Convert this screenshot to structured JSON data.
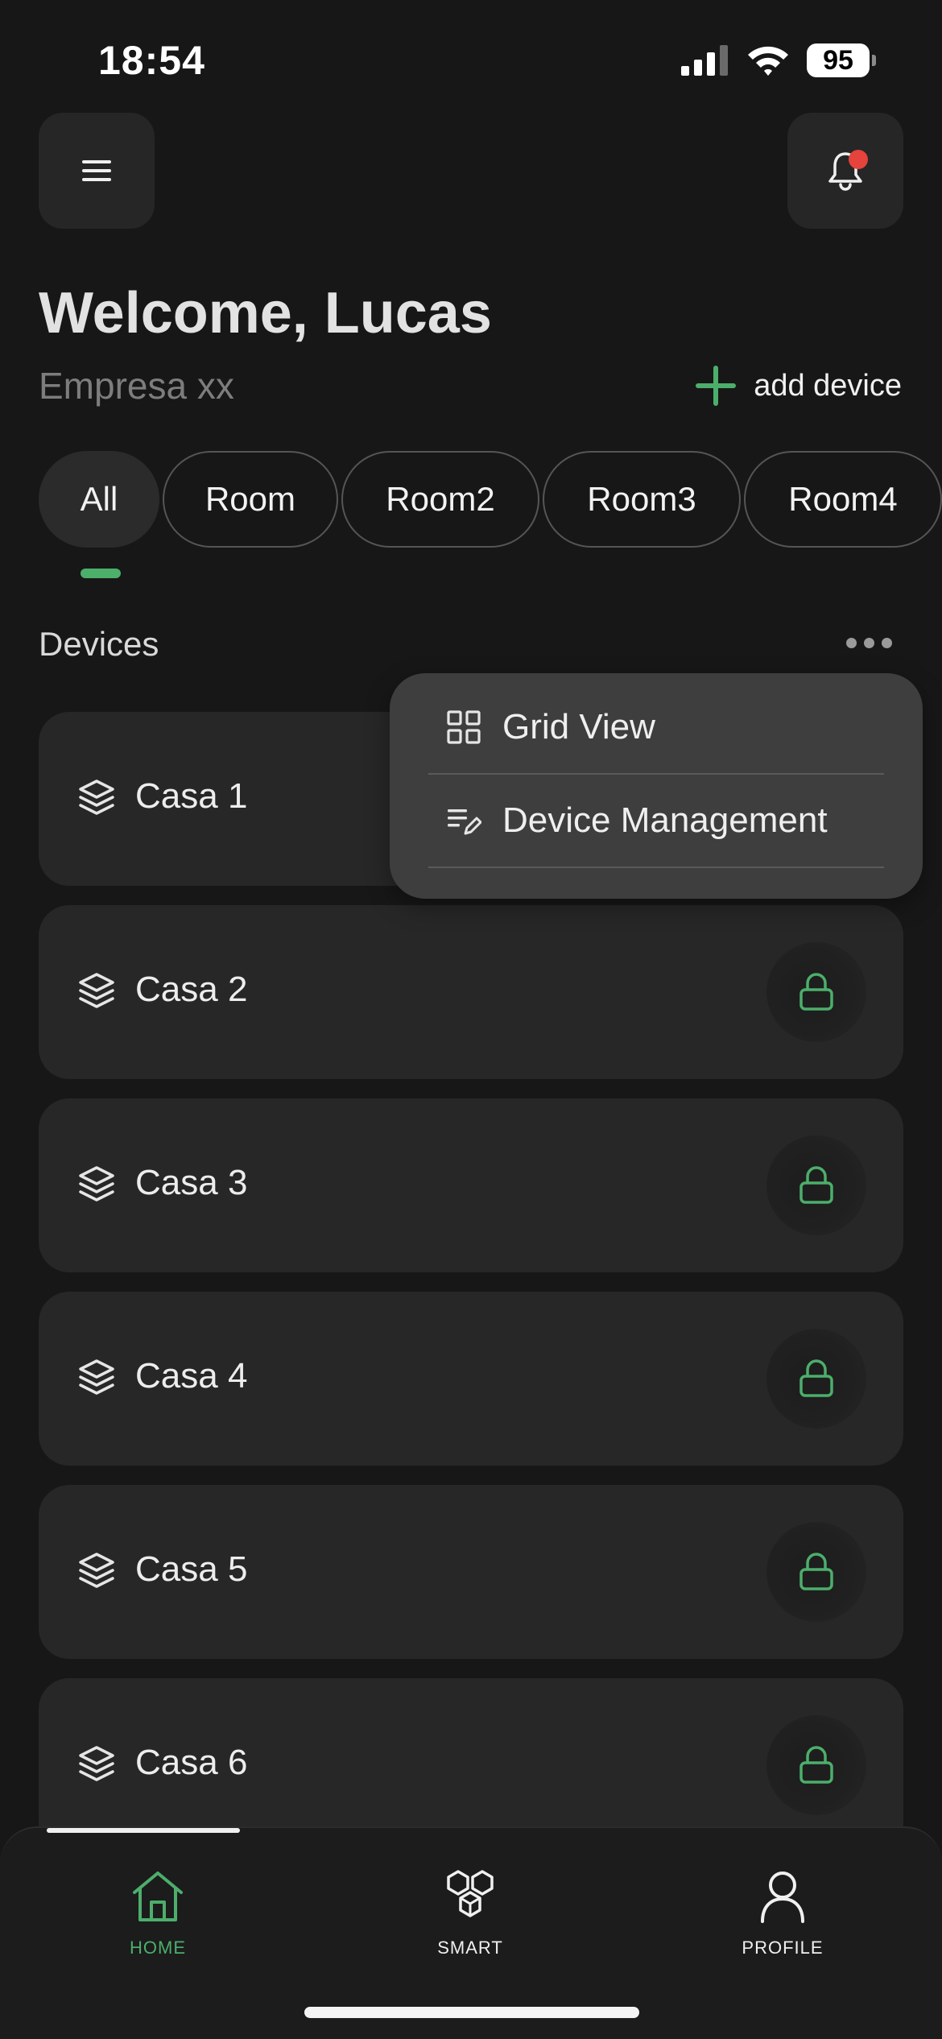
{
  "status_bar": {
    "time": "18:54",
    "battery": "95"
  },
  "header": {
    "title": "Welcome, Lucas",
    "company": "Empresa xx",
    "add_device_label": "add device"
  },
  "tabs": [
    {
      "label": "All",
      "active": true
    },
    {
      "label": "Room"
    },
    {
      "label": "Room2"
    },
    {
      "label": "Room3"
    },
    {
      "label": "Room4"
    }
  ],
  "section": {
    "title": "Devices"
  },
  "devices": [
    {
      "name": "Casa 1"
    },
    {
      "name": "Casa 2"
    },
    {
      "name": "Casa 3"
    },
    {
      "name": "Casa 4"
    },
    {
      "name": "Casa 5"
    },
    {
      "name": "Casa 6"
    }
  ],
  "popup_menu": {
    "items": [
      {
        "label": "Grid View"
      },
      {
        "label": "Device Management"
      }
    ]
  },
  "bottom_nav": {
    "items": [
      {
        "label": "HOME",
        "active": true
      },
      {
        "label": "SMART"
      },
      {
        "label": "PROFILE"
      }
    ]
  },
  "colors": {
    "accent": "#4cae6b",
    "background": "#171717",
    "card": "#272727",
    "notification": "#e5433b"
  }
}
